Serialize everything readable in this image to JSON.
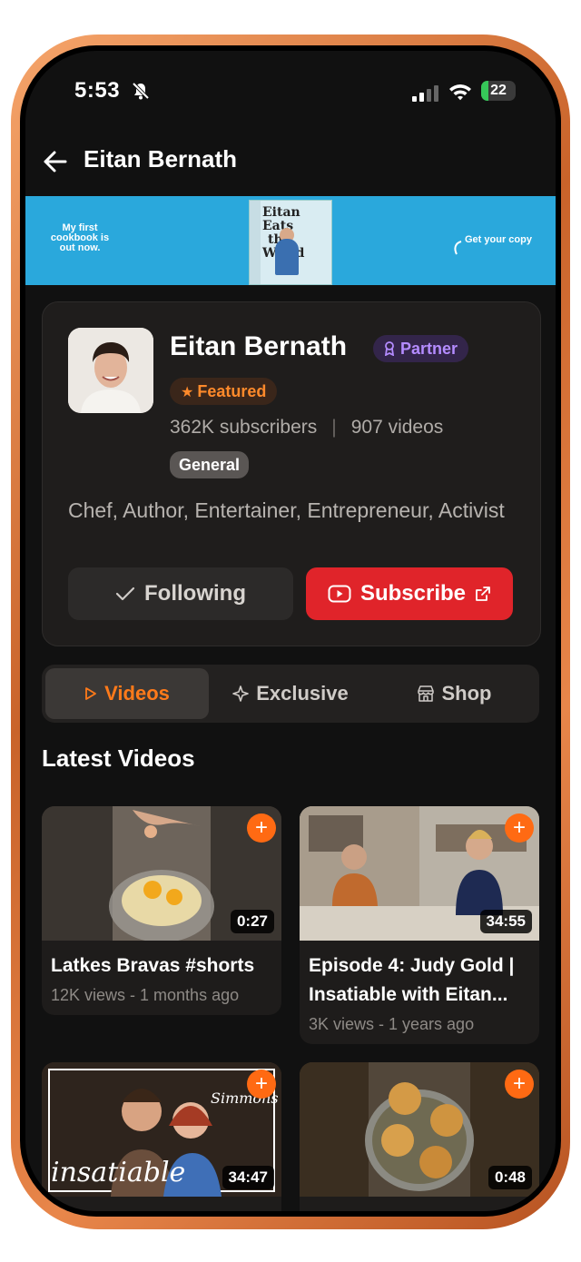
{
  "status": {
    "time": "5:53",
    "battery": "22",
    "battery_level": 0.22
  },
  "header": {
    "title": "Eitan Bernath"
  },
  "banner": {
    "left_text": "My first cookbook is out now.",
    "book_title_1": "Eitan Eats",
    "book_title_2": "the World",
    "right_text": "Get your copy"
  },
  "channel": {
    "name": "Eitan Bernath",
    "partner_label": "Partner",
    "featured_label": "Featured",
    "subscribers": "362K subscribers",
    "separator": "|",
    "videos_count": "907 videos",
    "category": "General",
    "bio": "Chef, Author, Entertainer, Entrepreneur, Activist",
    "following_label": "Following",
    "subscribe_label": "Subscribe"
  },
  "tabs": [
    {
      "label": "Videos",
      "active": true
    },
    {
      "label": "Exclusive",
      "active": false
    },
    {
      "label": "Shop",
      "active": false
    }
  ],
  "section_title": "Latest Videos",
  "videos": [
    {
      "title": "Latkes Bravas #shorts",
      "meta": "12K views - 1 months ago",
      "duration": "0:27"
    },
    {
      "title": "Episode 4: Judy Gold | Insatiable with Eitan...",
      "meta": "3K views - 1 years ago",
      "duration": "34:55"
    },
    {
      "duration": "34:47",
      "overlay_text": "insatiable",
      "overlay_brand": "Simmons"
    },
    {
      "duration": "0:48"
    }
  ],
  "colors": {
    "accent": "#ff7a1a",
    "subscribe": "#e0242a",
    "partner": "#b48cff",
    "banner": "#2aa8dc"
  }
}
